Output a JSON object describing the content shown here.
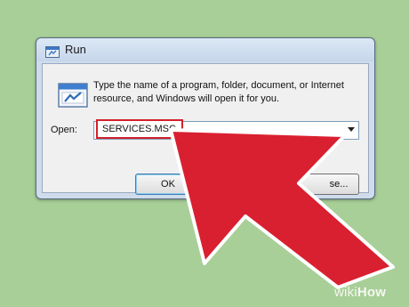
{
  "window": {
    "title": "Run",
    "description": "Type the name of a program, folder, document, or Internet resource, and Windows will open it for you."
  },
  "open_field": {
    "label": "Open:",
    "value": "SERVICES.MSC"
  },
  "buttons": {
    "ok": "OK",
    "cancel": "",
    "browse": "se..."
  },
  "watermark": {
    "prefix": "wiki",
    "suffix": "How"
  },
  "colors": {
    "background": "#a8cf98",
    "highlight": "#d4202b",
    "arrow": "#d92030",
    "arrow_outline": "#ffffff"
  }
}
